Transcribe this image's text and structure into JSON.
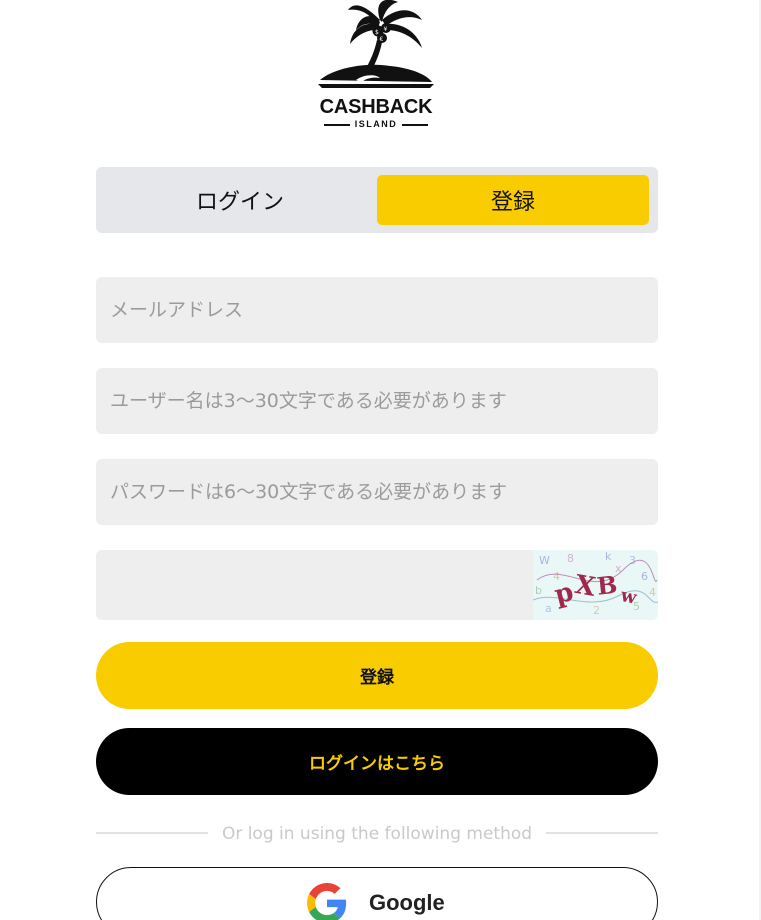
{
  "brand": {
    "name": "CASHBACK",
    "sub": "ISLAND",
    "logo_icon": "palm-island-icon"
  },
  "tabs": [
    {
      "label": "ログイン",
      "active": false
    },
    {
      "label": "登録",
      "active": true
    }
  ],
  "form": {
    "email_placeholder": "メールアドレス",
    "username_placeholder": "ユーザー名は3～30文字である必要があります",
    "password_placeholder": "パスワードは6～30文字である必要があります",
    "captcha_placeholder": "",
    "captcha_icon": "captcha-image"
  },
  "buttons": {
    "register": "登録",
    "login_here": "ログインはこちら"
  },
  "divider_text": "Or log in using the following method",
  "google": {
    "label": "Google",
    "icon": "google-icon"
  },
  "colors": {
    "accent": "#f9cc00",
    "dark": "#000000",
    "field_bg": "#eeeeee",
    "tab_bg": "#e6e7ea"
  }
}
